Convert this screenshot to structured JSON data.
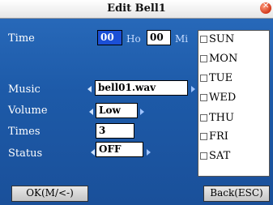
{
  "window": {
    "title": "Edit Bell1"
  },
  "form": {
    "time_label": "Time",
    "hour_value": "00",
    "hour_unit": "Ho",
    "minute_value": "00",
    "minute_unit": "Mi",
    "music_label": "Music",
    "music_value": "bell01.wav",
    "volume_label": "Volume",
    "volume_value": "Low",
    "times_label": "Times",
    "times_value": "3",
    "status_label": "Status",
    "status_value": "OFF"
  },
  "days": [
    "SUN",
    "MON",
    "TUE",
    "WED",
    "THU",
    "FRI",
    "SAT"
  ],
  "buttons": {
    "ok": "OK(M/<-)",
    "back": "Back(ESC)"
  },
  "colors": {
    "background": "#1d5aa8",
    "focus": "#1b4fd6"
  }
}
